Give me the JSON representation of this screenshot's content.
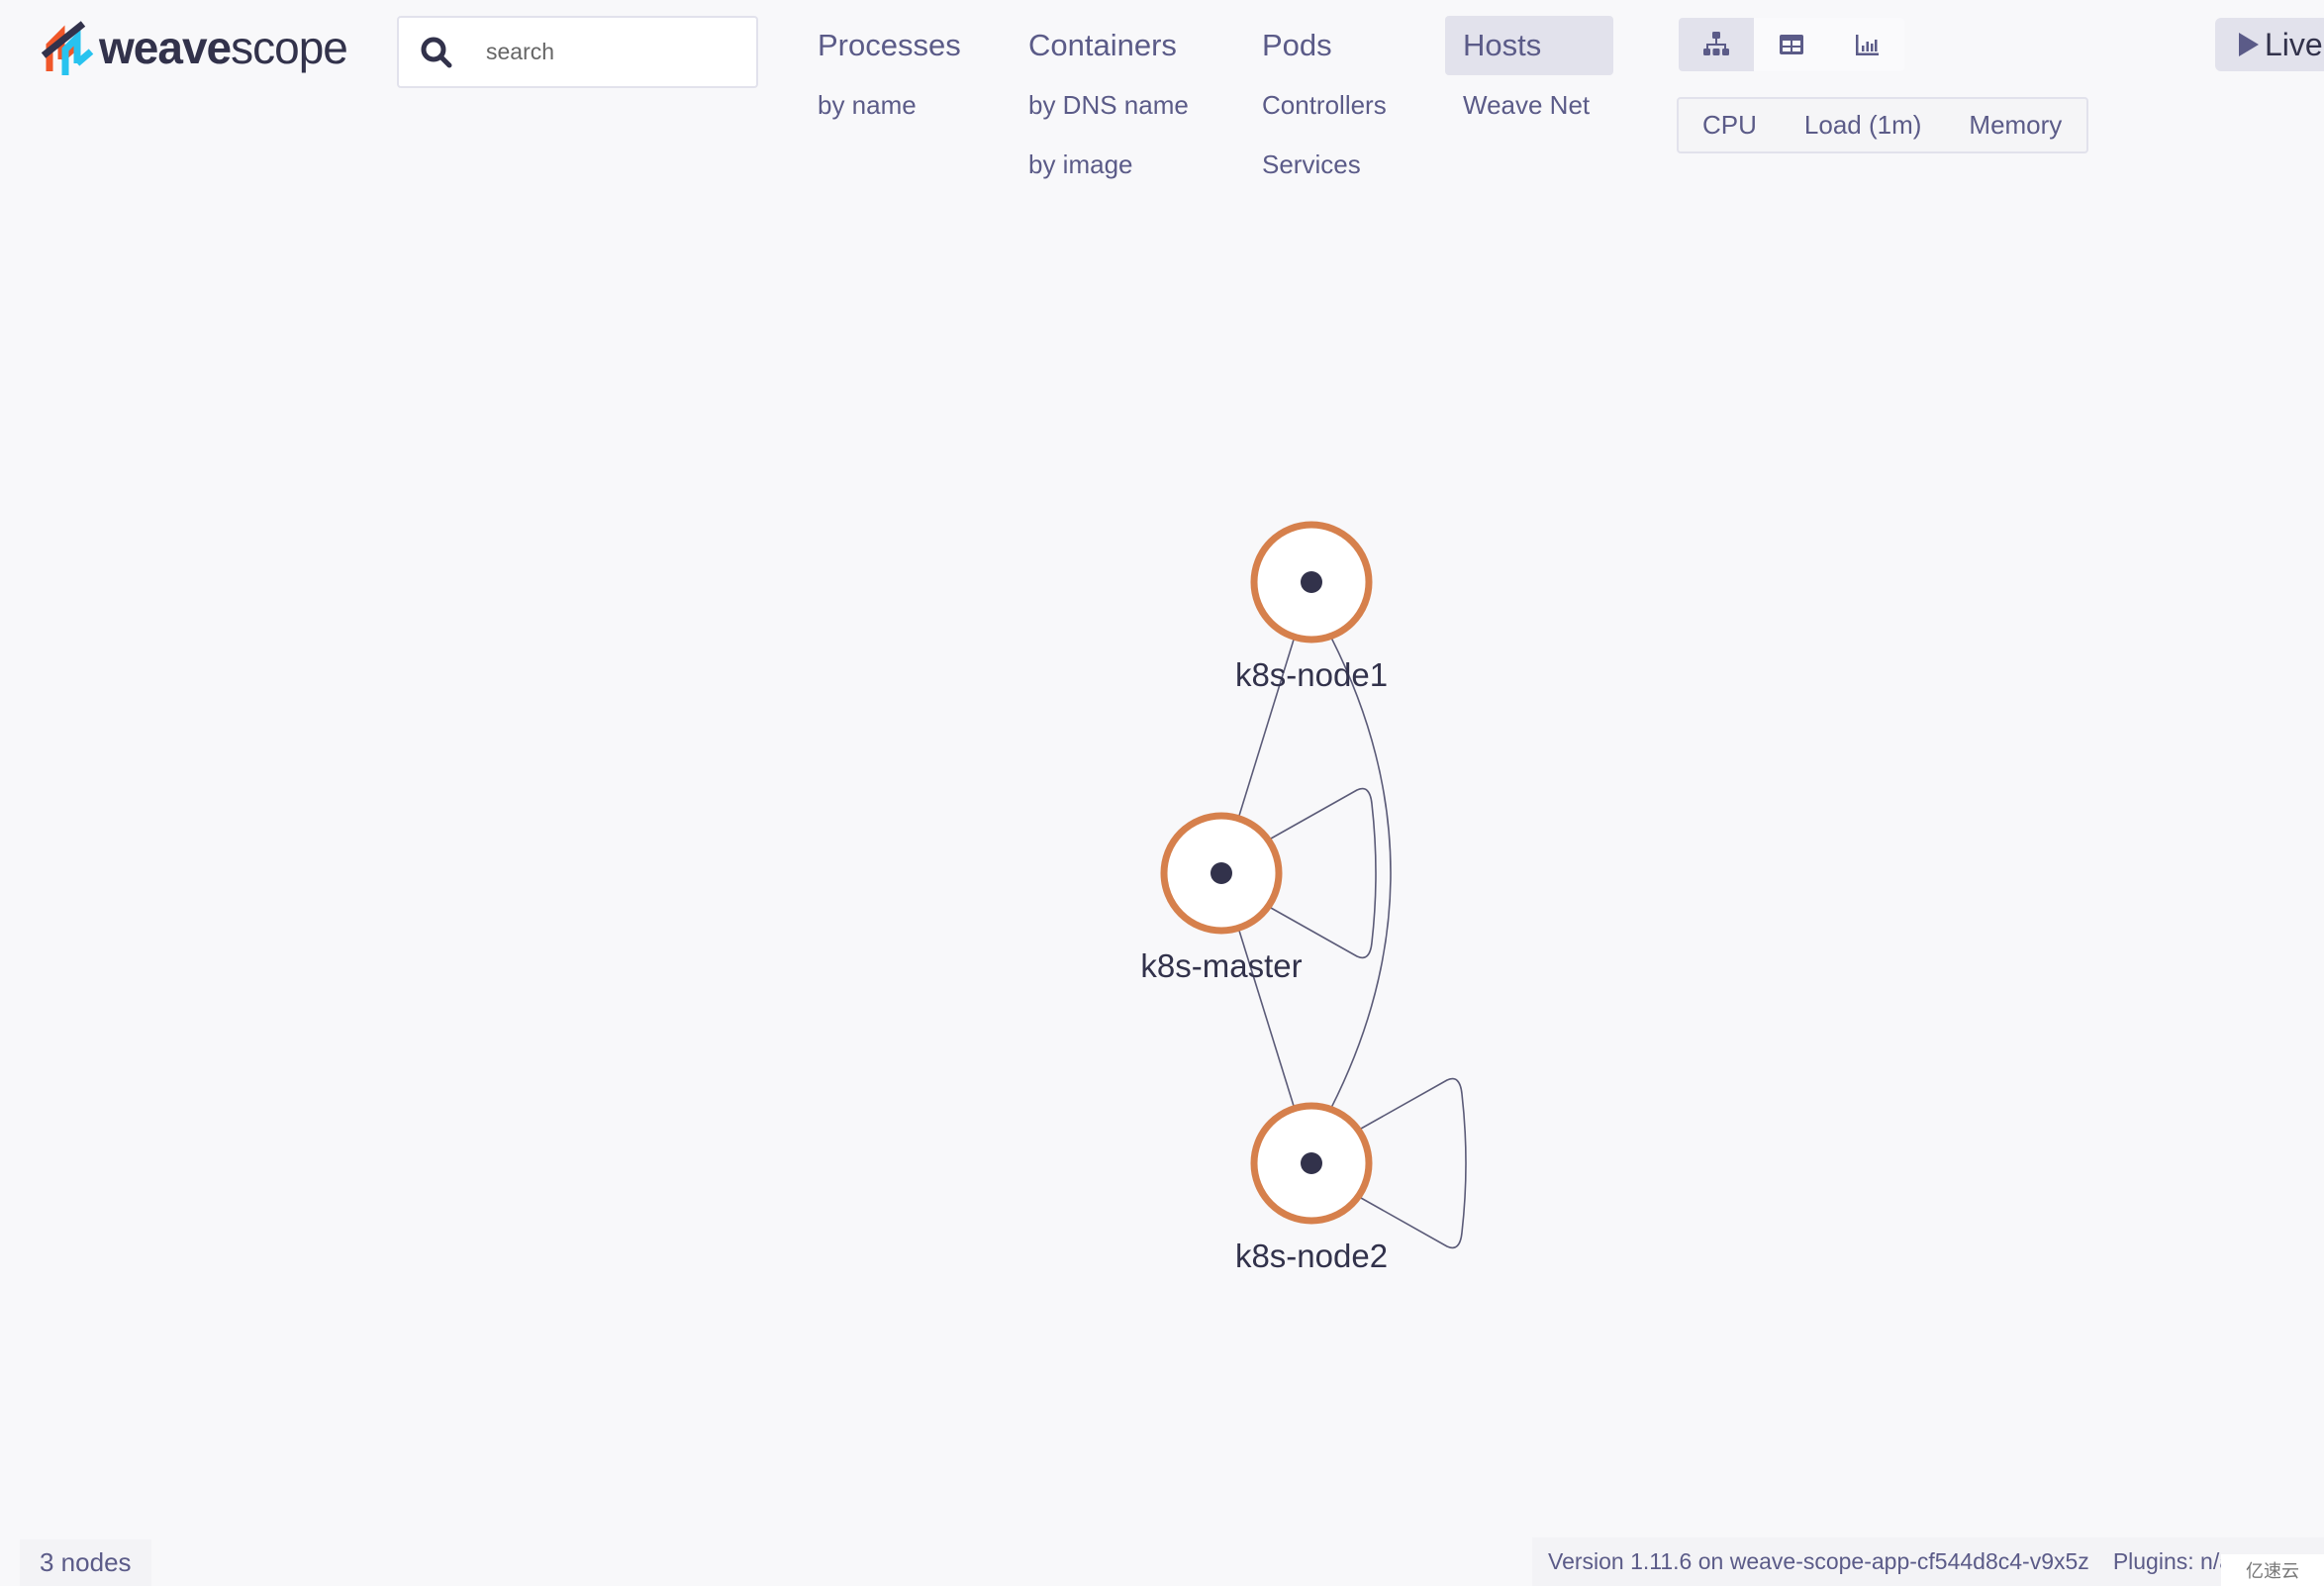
{
  "app": {
    "logo_bold": "weave",
    "logo_light": "scope"
  },
  "search": {
    "placeholder": "search",
    "value": ""
  },
  "topologies": [
    {
      "label": "Processes",
      "active": false,
      "sub": [
        {
          "label": "by name"
        }
      ]
    },
    {
      "label": "Containers",
      "active": false,
      "sub": [
        {
          "label": "by DNS name"
        },
        {
          "label": "by image"
        }
      ]
    },
    {
      "label": "Pods",
      "active": false,
      "sub": [
        {
          "label": "Controllers"
        },
        {
          "label": "Services"
        }
      ]
    },
    {
      "label": "Hosts",
      "active": true,
      "sub": [
        {
          "label": "Weave Net"
        }
      ]
    }
  ],
  "view_modes": [
    {
      "name": "graph-view",
      "icon": "topology-icon",
      "active": true
    },
    {
      "name": "table-view",
      "icon": "table-icon",
      "active": false
    },
    {
      "name": "resources-view",
      "icon": "bar-chart-icon",
      "active": false
    }
  ],
  "metrics": [
    "CPU",
    "Load (1m)",
    "Memory"
  ],
  "live_button": {
    "label": "Live",
    "icon": "play-icon"
  },
  "graph": {
    "nodes": [
      {
        "id": "k8s-node1",
        "label": "k8s-node1"
      },
      {
        "id": "k8s-master",
        "label": "k8s-master"
      },
      {
        "id": "k8s-node2",
        "label": "k8s-node2"
      }
    ],
    "edges": [
      {
        "source": "k8s-node1",
        "target": "k8s-master"
      },
      {
        "source": "k8s-node1",
        "target": "k8s-node2"
      },
      {
        "source": "k8s-master",
        "target": "k8s-node2"
      },
      {
        "source": "k8s-master",
        "target": "k8s-master"
      },
      {
        "source": "k8s-node2",
        "target": "k8s-node2"
      }
    ],
    "colors": {
      "node_ring": "#d6804c",
      "node_fill": "#ffffff",
      "node_dot": "#32324b",
      "edge": "#5b5b78"
    }
  },
  "footer": {
    "node_count": "3 nodes",
    "version": "Version 1.11.6 on weave-scope-app-cf544d8c4-v9x5z",
    "plugins": "Plugins: n/a",
    "watermark": "亿速云"
  }
}
